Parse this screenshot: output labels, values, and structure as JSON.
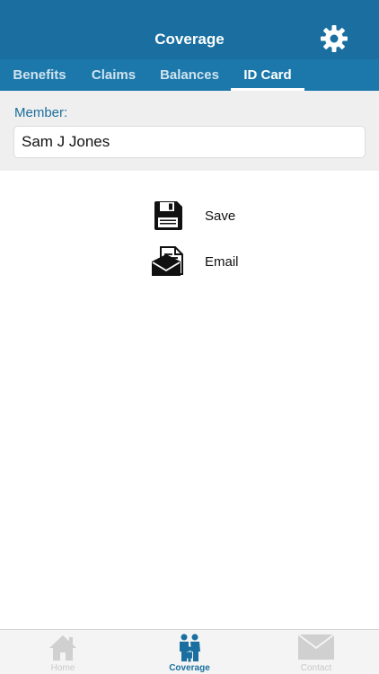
{
  "header": {
    "title": "Coverage",
    "settings_icon": "gear-icon",
    "color": "#1a6fa0"
  },
  "tabs": [
    {
      "label": "Benefits",
      "active": false
    },
    {
      "label": "Claims",
      "active": false
    },
    {
      "label": "Balances",
      "active": false
    },
    {
      "label": "ID Card",
      "active": true
    }
  ],
  "member": {
    "label": "Member:",
    "value": "Sam J Jones"
  },
  "actions": [
    {
      "label": "Save",
      "icon": "floppy-disk-icon"
    },
    {
      "label": "Email",
      "icon": "envelope-document-icon"
    }
  ],
  "bottom_nav": [
    {
      "label": "Home",
      "icon": "home-icon",
      "active": false
    },
    {
      "label": "Coverage",
      "icon": "family-icon",
      "active": true
    },
    {
      "label": "Contact",
      "icon": "mail-icon",
      "active": false
    }
  ],
  "colors": {
    "accent": "#1a6fa0",
    "inactive_nav": "#c9c9c9"
  }
}
